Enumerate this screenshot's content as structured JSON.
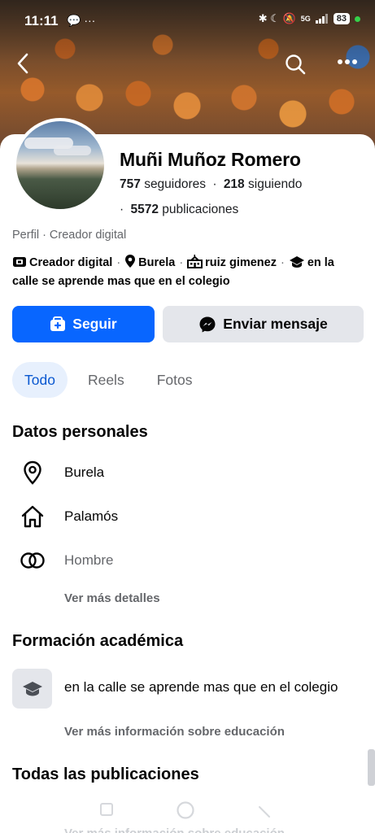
{
  "status_bar": {
    "time": "11:11",
    "left_icons": "💬 ···",
    "right_icons": "✱ ☾ 🔕",
    "network": "5G",
    "battery": "83"
  },
  "profile": {
    "name": "Muñi Muñoz Romero",
    "followers_count": "757",
    "followers_label": "seguidores",
    "following_count": "218",
    "following_label": "siguiendo",
    "posts_count": "5572",
    "posts_label": "publicaciones",
    "stats_separator": "·",
    "profile_type": "Perfil · Creador digital"
  },
  "intro": {
    "item1": "Creador digital",
    "item2": "Burela",
    "item3": "ruiz gimenez",
    "item4": "en la calle se aprende mas que en el colegio",
    "separator": "·"
  },
  "actions": {
    "follow_label": "Seguir",
    "message_label": "Enviar mensaje"
  },
  "tabs": [
    {
      "label": "Todo",
      "active": true
    },
    {
      "label": "Reels",
      "active": false
    },
    {
      "label": "Fotos",
      "active": false
    }
  ],
  "personal": {
    "title": "Datos personales",
    "location": "Burela",
    "hometown": "Palamós",
    "gender": "Hombre",
    "more_details": "Ver más detalles"
  },
  "education": {
    "title": "Formación académica",
    "school": "en la calle se aprende mas que en el colegio",
    "more_info": "Ver más información sobre educación"
  },
  "posts": {
    "title": "Todas las publicaciones"
  },
  "colors": {
    "accent": "#0866ff",
    "tab_active_bg": "#e7f0fd",
    "secondary_button": "#e4e6eb",
    "muted_text": "#65676b"
  }
}
